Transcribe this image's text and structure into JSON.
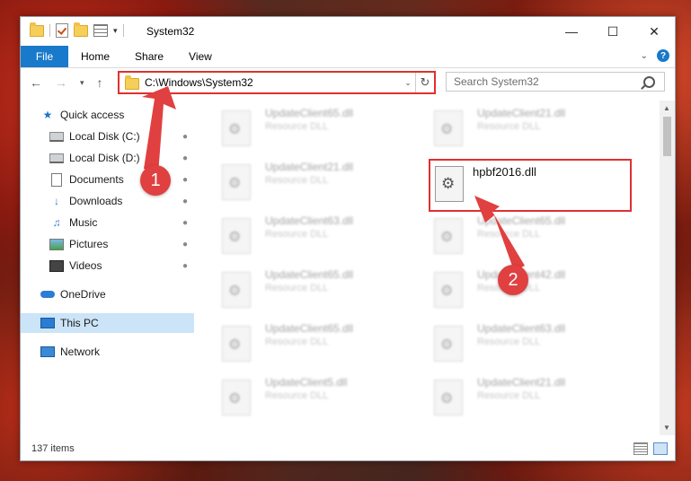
{
  "window": {
    "title": "System32"
  },
  "ribbon": {
    "tabs": [
      "File",
      "Home",
      "Share",
      "View"
    ]
  },
  "address": {
    "path": "C:\\Windows\\System32"
  },
  "search": {
    "placeholder": "Search System32"
  },
  "sidebar": {
    "items": [
      {
        "label": "Quick access",
        "icon": "star-icon",
        "pinned": false
      },
      {
        "label": "Local Disk (C:)",
        "icon": "drive-icon",
        "pinned": true
      },
      {
        "label": "Local Disk (D:)",
        "icon": "drive-icon",
        "pinned": true
      },
      {
        "label": "Documents",
        "icon": "documents-icon",
        "pinned": true
      },
      {
        "label": "Downloads",
        "icon": "downloads-icon",
        "pinned": true
      },
      {
        "label": "Music",
        "icon": "music-icon",
        "pinned": true
      },
      {
        "label": "Pictures",
        "icon": "pictures-icon",
        "pinned": true
      },
      {
        "label": "Videos",
        "icon": "videos-icon",
        "pinned": true
      },
      {
        "label": "OneDrive",
        "icon": "onedrive-icon",
        "pinned": false
      },
      {
        "label": "This PC",
        "icon": "pc-icon",
        "pinned": false,
        "selected": true
      },
      {
        "label": "Network",
        "icon": "network-icon",
        "pinned": false
      }
    ]
  },
  "files": [
    {
      "name": "UpdateClient65.dll",
      "type": "Resource DLL"
    },
    {
      "name": "UpdateClient21.dll",
      "type": "Resource DLL"
    },
    {
      "name": "UpdateClient21.dll",
      "type": "Resource DLL"
    },
    {
      "name": "UpdateClient63.dll",
      "type": "Resource DLL"
    },
    {
      "name": "UpdateClient65.dll",
      "type": "Resource DLL"
    },
    {
      "name": "UpdateClient65.dll",
      "type": "Resource DLL"
    },
    {
      "name": "UpdateClient42.dll",
      "type": "Resource DLL"
    },
    {
      "name": "UpdateClient65.dll",
      "type": "Resource DLL"
    },
    {
      "name": "UpdateClient63.dll",
      "type": "Resource DLL"
    },
    {
      "name": "UpdateClient5.dll",
      "type": "Resource DLL"
    },
    {
      "name": "UpdateClient21.dll",
      "type": "Resource DLL"
    }
  ],
  "highlighted_file": {
    "name": "hpbf2016.dll"
  },
  "status": {
    "count": "137 items"
  },
  "markers": [
    "1",
    "2"
  ],
  "colors": {
    "accent": "#1979ca",
    "highlight": "#e03030",
    "marker": "#e04040"
  }
}
